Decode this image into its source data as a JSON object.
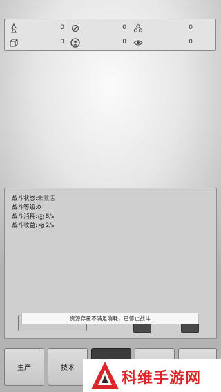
{
  "resources": [
    {
      "icon": "crystal-icon",
      "value": "0"
    },
    {
      "icon": "gear-icon",
      "value": "0"
    },
    {
      "icon": "triangle-cluster-icon",
      "value": "0"
    },
    {
      "icon": "box-icon",
      "value": "0"
    },
    {
      "icon": "person-badge-icon",
      "value": "0"
    },
    {
      "icon": "eye-icon",
      "value": "0"
    }
  ],
  "battle": {
    "status_label": "战斗状态:",
    "status_value": "未激活",
    "level_label": "战斗等级:",
    "level_value": "0",
    "consume_label": "战斗消耗:",
    "consume_value": "8/s",
    "income_label": "战斗收益:",
    "income_value": "2/s"
  },
  "toast": "资源存量不满足消耗，已停止战斗",
  "tabs": [
    {
      "label": "生产"
    },
    {
      "label": "技术"
    }
  ],
  "watermark": "科维手游网",
  "colors": {
    "watermark_red": "#d8262b",
    "active_tab": "#3c3c3c"
  }
}
